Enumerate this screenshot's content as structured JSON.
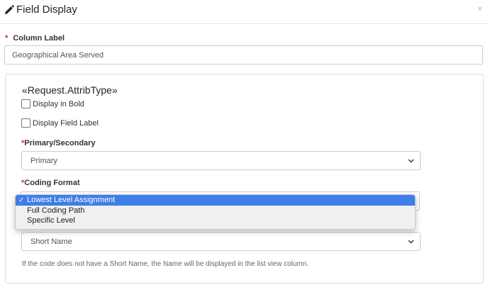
{
  "dialog": {
    "title": "Field Display",
    "close_symbol": "×"
  },
  "column_label": {
    "required_mark": "*",
    "label": "Column Label",
    "value": "Geographical Area Served"
  },
  "panel": {
    "attrib_type": "«Request.AttribType»",
    "checkbox_bold": {
      "label": "Display in Bold",
      "checked": false
    },
    "checkbox_field_label": {
      "label": "Display Field Label",
      "checked": false
    },
    "primary_secondary": {
      "required_mark": "*",
      "label": "Primary/Secondary",
      "selected": "Primary"
    },
    "coding_format": {
      "required_mark": "*",
      "label": "Coding Format",
      "options": [
        "Lowest Level Assignment",
        "Full Coding Path",
        "Specific Level"
      ],
      "selected_index": 0,
      "check_mark": "✓"
    },
    "name_display": {
      "selected": "Short Name"
    },
    "help_text": "If the code does not have a Short Name, the Name will be displayed in the list view column."
  },
  "colors": {
    "required": "#c9302c",
    "selection": "#3d7ee8"
  },
  "icons": {
    "title": "pencil-icon",
    "close": "close-icon",
    "select": "chevron-down-icon"
  }
}
